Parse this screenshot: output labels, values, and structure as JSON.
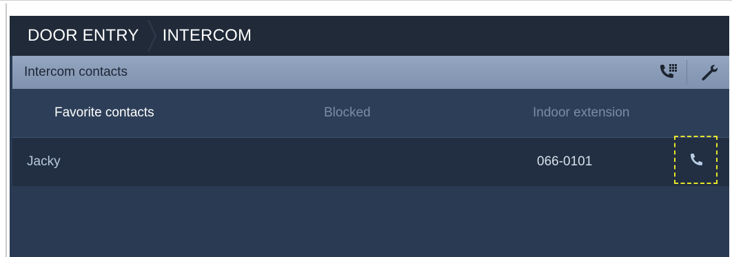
{
  "breadcrumb": {
    "items": [
      "DOOR ENTRY",
      "INTERCOM"
    ]
  },
  "section": {
    "title": "Intercom contacts"
  },
  "toolbar": {
    "icons": [
      "dialpad-phone-icon",
      "wrench-icon"
    ]
  },
  "tabs": [
    {
      "label": "Favorite contacts",
      "active": true
    },
    {
      "label": "Blocked",
      "active": false
    },
    {
      "label": "Indoor extension",
      "active": false
    }
  ],
  "contacts": [
    {
      "name": "Jacky",
      "number": "066-0101",
      "action_icon": "phone-icon"
    }
  ],
  "colors": {
    "titlebar": "#202a38",
    "section_bar": "#8b9db8",
    "background": "#2a3a52",
    "row": "#222f42",
    "highlight": "#e8e62a"
  }
}
